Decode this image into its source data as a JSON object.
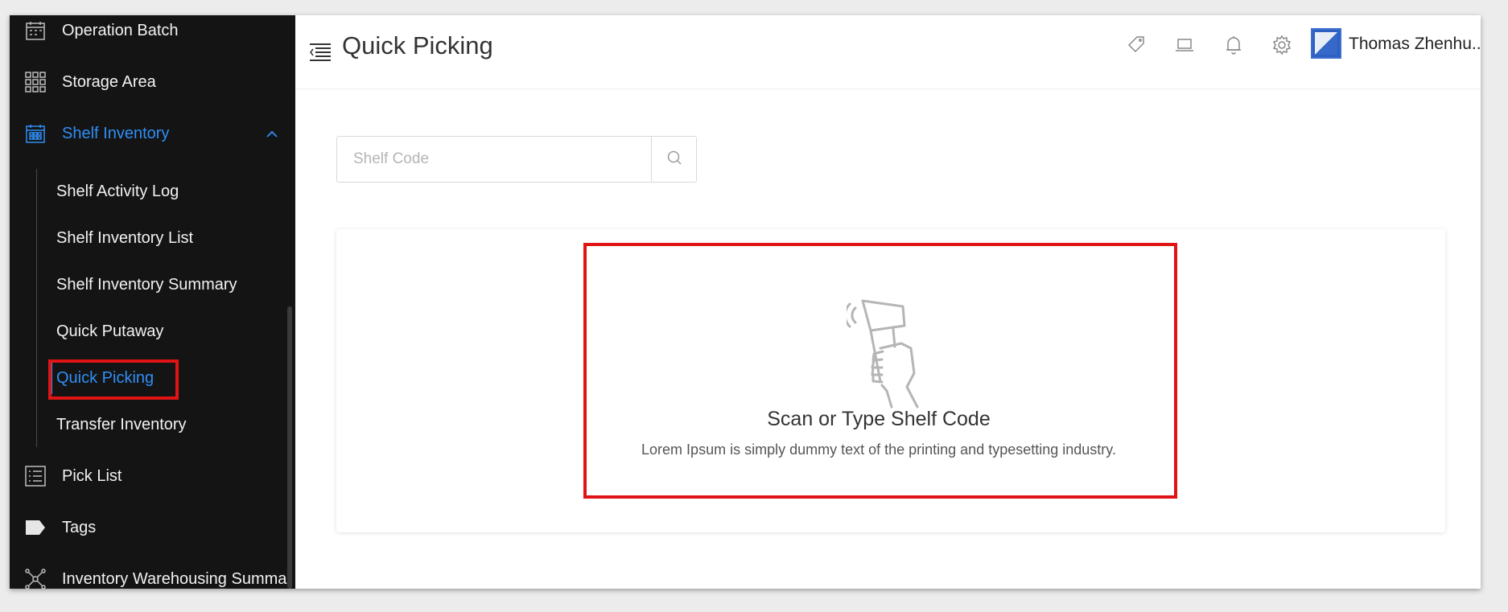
{
  "sidebar": {
    "items": [
      {
        "label": "Operation Batch",
        "icon": "calendar-icon"
      },
      {
        "label": "Storage Area",
        "icon": "grid-icon"
      },
      {
        "label": "Shelf Inventory",
        "icon": "calendar-icon"
      },
      {
        "label": "Pick List",
        "icon": "list-icon"
      },
      {
        "label": "Tags",
        "icon": "tag-icon"
      },
      {
        "label": "Inventory Warehousing Summar",
        "icon": "network-icon"
      }
    ],
    "sub_items": [
      {
        "label": "Shelf Activity Log"
      },
      {
        "label": "Shelf Inventory List"
      },
      {
        "label": "Shelf Inventory Summary"
      },
      {
        "label": "Quick Putaway"
      },
      {
        "label": "Quick Picking"
      },
      {
        "label": "Transfer Inventory"
      }
    ]
  },
  "header": {
    "title": "Quick Picking",
    "username": "Thomas Zhenhu.."
  },
  "search": {
    "placeholder": "Shelf Code",
    "value": ""
  },
  "empty_state": {
    "title": "Scan or Type Shelf Code",
    "description": "Lorem Ipsum is simply dummy text of the printing and typesetting industry."
  },
  "colors": {
    "sidebar_bg": "#141414",
    "accent": "#2f8ef5",
    "highlight": "#e01414"
  }
}
